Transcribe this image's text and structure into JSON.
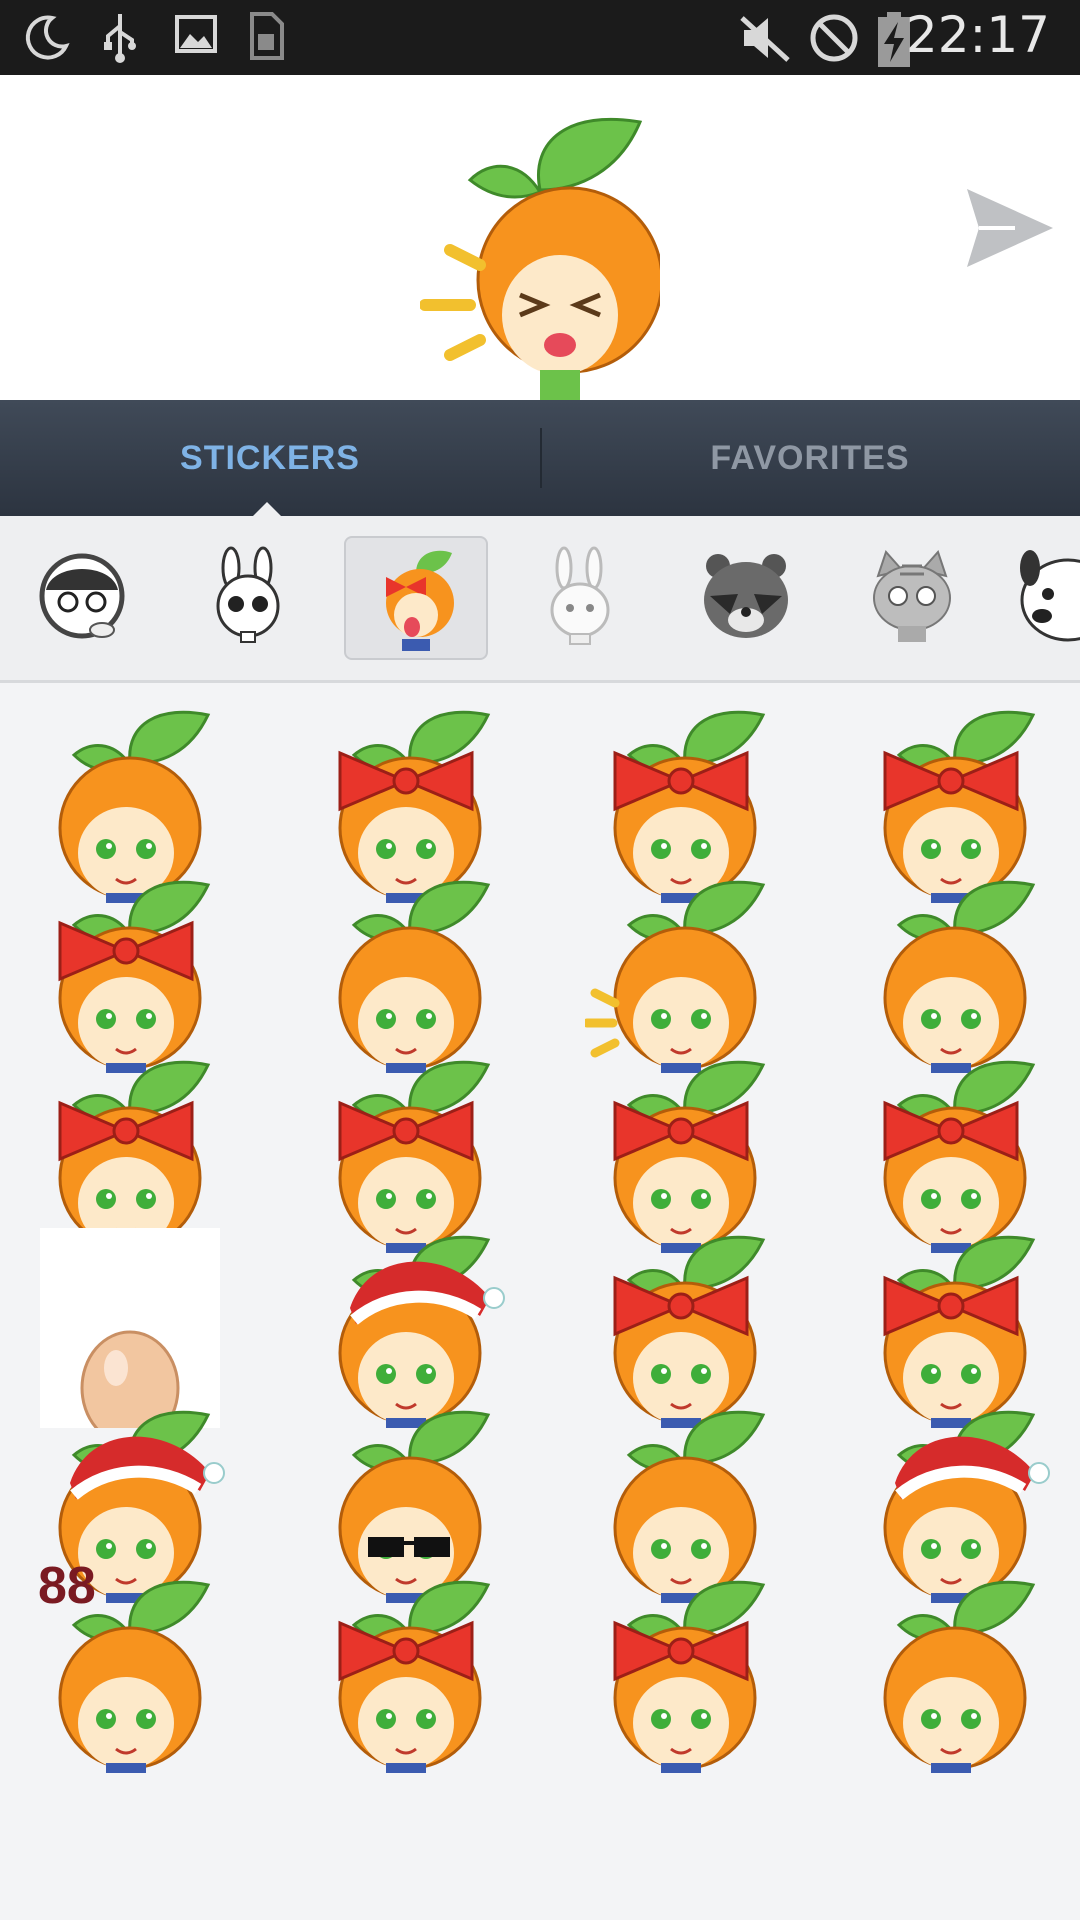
{
  "status_bar": {
    "time": "22:17",
    "icons": [
      "moon-icon",
      "usb-icon",
      "image-icon",
      "sim-icon",
      "mute-icon",
      "block-icon",
      "battery-charging-icon"
    ]
  },
  "preview": {
    "sticker": "orange-boy-shouting-sticker",
    "send_icon": "send-icon"
  },
  "tabs": {
    "stickers": "STICKERS",
    "favorites": "FAVORITES",
    "active": "stickers"
  },
  "colors": {
    "status_bg": "#1b1b1b",
    "tab_bg": "#2c3440",
    "tab_active": "#7fb3e6",
    "tab_inactive": "#8f98a4",
    "orange": "#f7931e",
    "leaf": "#6cc24a",
    "bow": "#e8352b",
    "skin": "#fde9c9"
  },
  "categories": [
    {
      "name": "boy-glasses-pack",
      "selected": false
    },
    {
      "name": "white-rabbit-pack",
      "selected": false
    },
    {
      "name": "orange-kids-pack",
      "selected": true
    },
    {
      "name": "grey-rabbit-pack",
      "selected": false
    },
    {
      "name": "raccoon-pack",
      "selected": false
    },
    {
      "name": "tabby-cat-pack",
      "selected": false
    },
    {
      "name": "dog-pack",
      "selected": false
    }
  ],
  "stickers": [
    {
      "name": "new-year-couple-sticker",
      "text": ""
    },
    {
      "name": "girl-smile-sticker",
      "text": ""
    },
    {
      "name": "girl-sweat-sticker",
      "text": ""
    },
    {
      "name": "girl-annoyed-sticker",
      "text": ""
    },
    {
      "name": "girl-hug-boy-sticker",
      "text": ""
    },
    {
      "name": "boy-ice-sticker",
      "text": ""
    },
    {
      "name": "boy-shouting-sticker",
      "text": ""
    },
    {
      "name": "boy-angry-sticker",
      "text": ""
    },
    {
      "name": "girl-happy-sticker",
      "text": ""
    },
    {
      "name": "girl-grin-sticker",
      "text": ""
    },
    {
      "name": "girl-laugh-sticker",
      "text": ""
    },
    {
      "name": "girl-peek-sticker",
      "text": ""
    },
    {
      "name": "egg-sticker",
      "text": ""
    },
    {
      "name": "santa-hat-girl-sticker",
      "text": ""
    },
    {
      "name": "girl-dizzy-sticker",
      "text": ""
    },
    {
      "name": "girl-lying-sticker",
      "text": ""
    },
    {
      "name": "sleigh-sticker",
      "text": ""
    },
    {
      "name": "boy-sunglasses-sticker",
      "text": ""
    },
    {
      "name": "boy-bowl-sticker",
      "text": ""
    },
    {
      "name": "reindeer-santa-sticker",
      "text": ""
    },
    {
      "name": "boy-bye-88-sticker",
      "text": "88"
    },
    {
      "name": "girl-wink-sticker",
      "text": ""
    },
    {
      "name": "girl-bow-sticker",
      "text": ""
    },
    {
      "name": "couple-hug-sticker",
      "text": ""
    }
  ]
}
